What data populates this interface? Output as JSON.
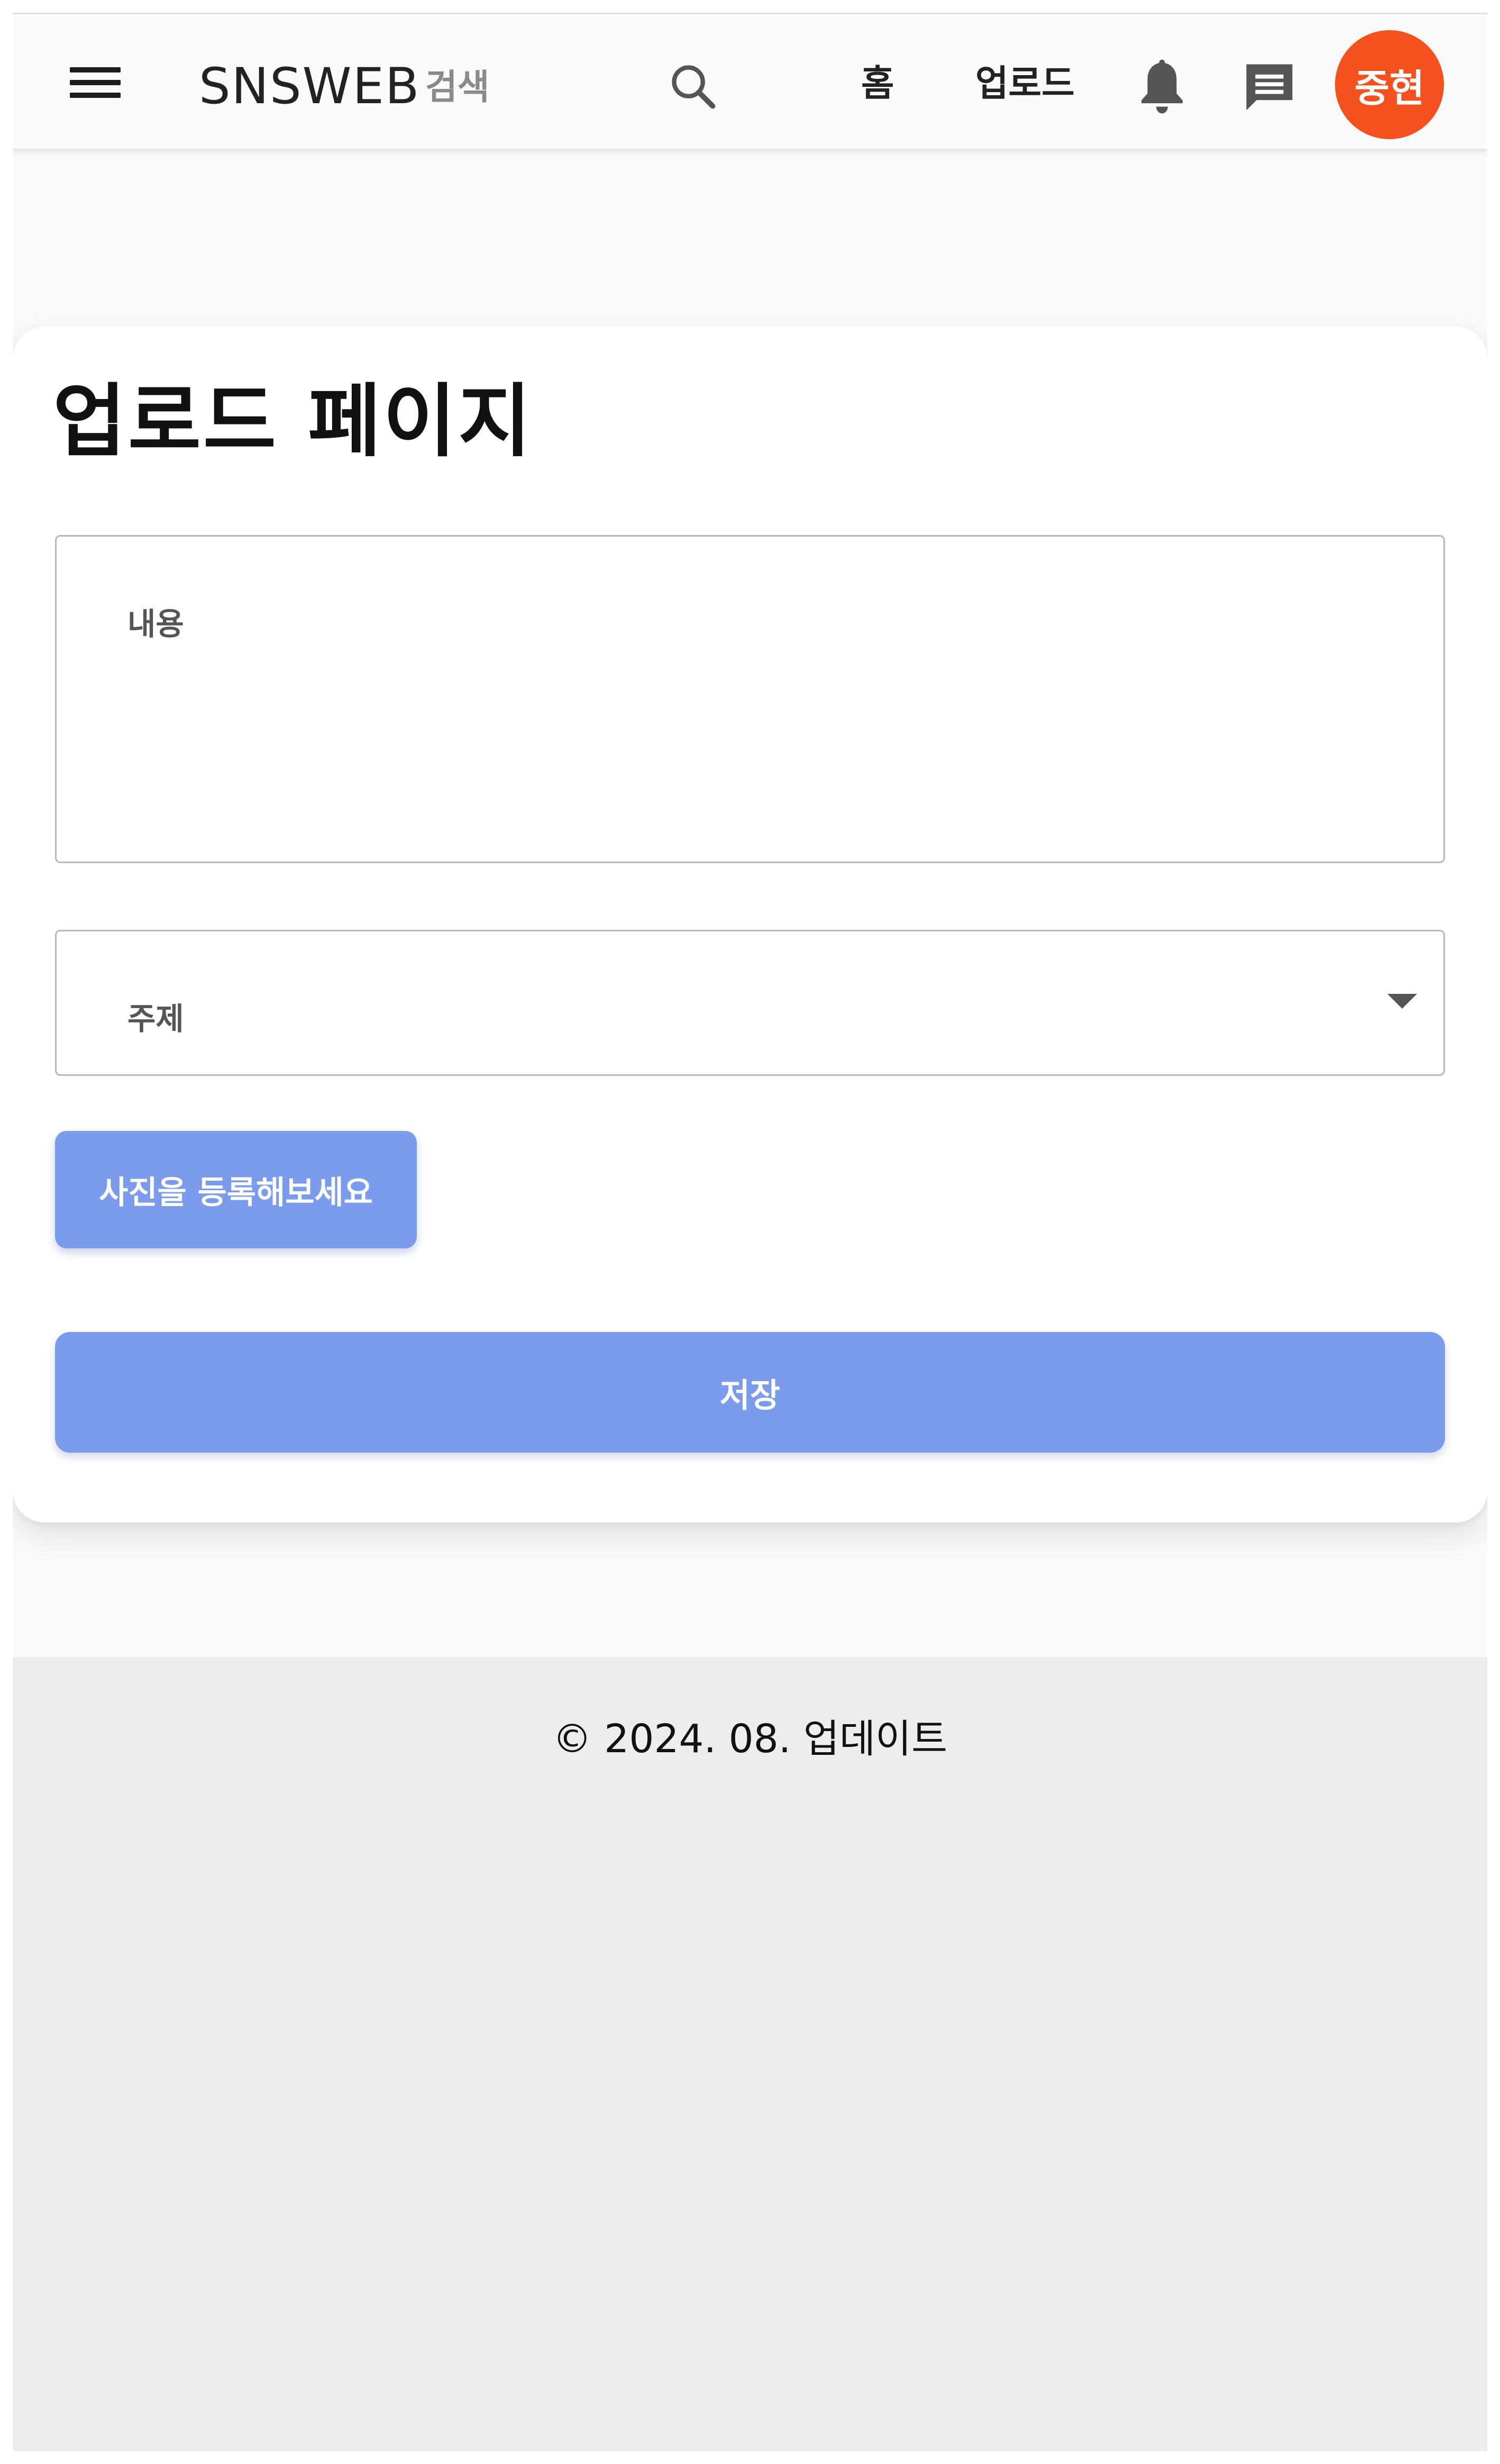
{
  "header": {
    "brand": "SNSWEB",
    "search_label": "검색",
    "nav_home": "홈",
    "nav_upload": "업로드",
    "avatar_text": "중현"
  },
  "icons": {
    "menu": "menu-icon",
    "search": "search-icon",
    "notification": "bell-icon",
    "messages": "chat-icon",
    "dropdown": "caret-down-icon"
  },
  "main": {
    "title": "업로드 페이지",
    "content_label": "내용",
    "content_value": "",
    "topic_label": "주제",
    "topic_value": "",
    "photo_button": "사진을 등록해보세요",
    "save_button": "저장"
  },
  "footer": {
    "text": "© 2024. 08. 업데이트"
  },
  "colors": {
    "accent": "#7b9cec",
    "avatar": "#f4511e",
    "footer_bg": "#ededed"
  }
}
